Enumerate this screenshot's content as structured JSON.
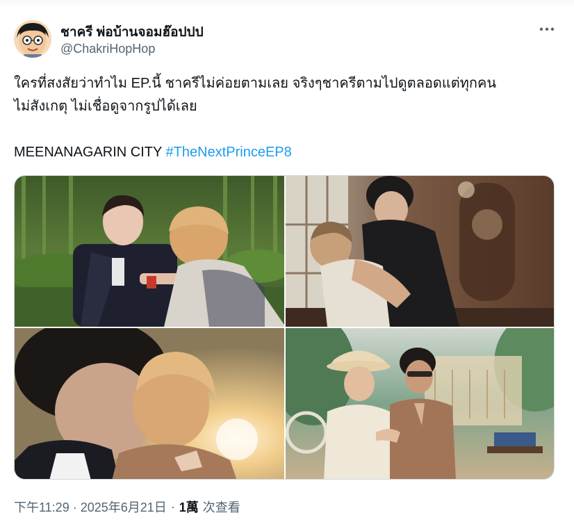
{
  "author": {
    "display_name": "ชาครี พ่อบ้านจอมฮ๊อปปป",
    "handle": "@ChakriHopHop",
    "avatar_icon": "cartoon-face-glasses-avatar"
  },
  "tweet": {
    "text_line_1": "ใครที่สงสัยว่าทำไม EP.นี้ ชาครีไม่ค่อยตามเลย จริงๆชาครีตามไปดูตลอดแต่ทุกคน",
    "text_line_2": "ไม่สังเกตุ ไม่เชื่อดูจากรูปได้เลย",
    "text_line_3_prefix": "MEENANAGARIN CITY ",
    "hashtag": "#TheNextPrinceEP8"
  },
  "media": {
    "count": 4,
    "items": [
      "photo-garden-two-men",
      "photo-room-embrace",
      "photo-sunset-kiss",
      "photo-beach-two-men"
    ]
  },
  "meta": {
    "time_date": "下午11:29 · 2025年6月21日",
    "separator": "·",
    "views_count": "1萬",
    "views_label": "次查看"
  },
  "colors": {
    "text_primary": "#0f1419",
    "text_secondary": "#536471",
    "link": "#1d9bf0",
    "border": "#cfd9de"
  },
  "icons": {
    "more": "more-horizontal-icon"
  }
}
